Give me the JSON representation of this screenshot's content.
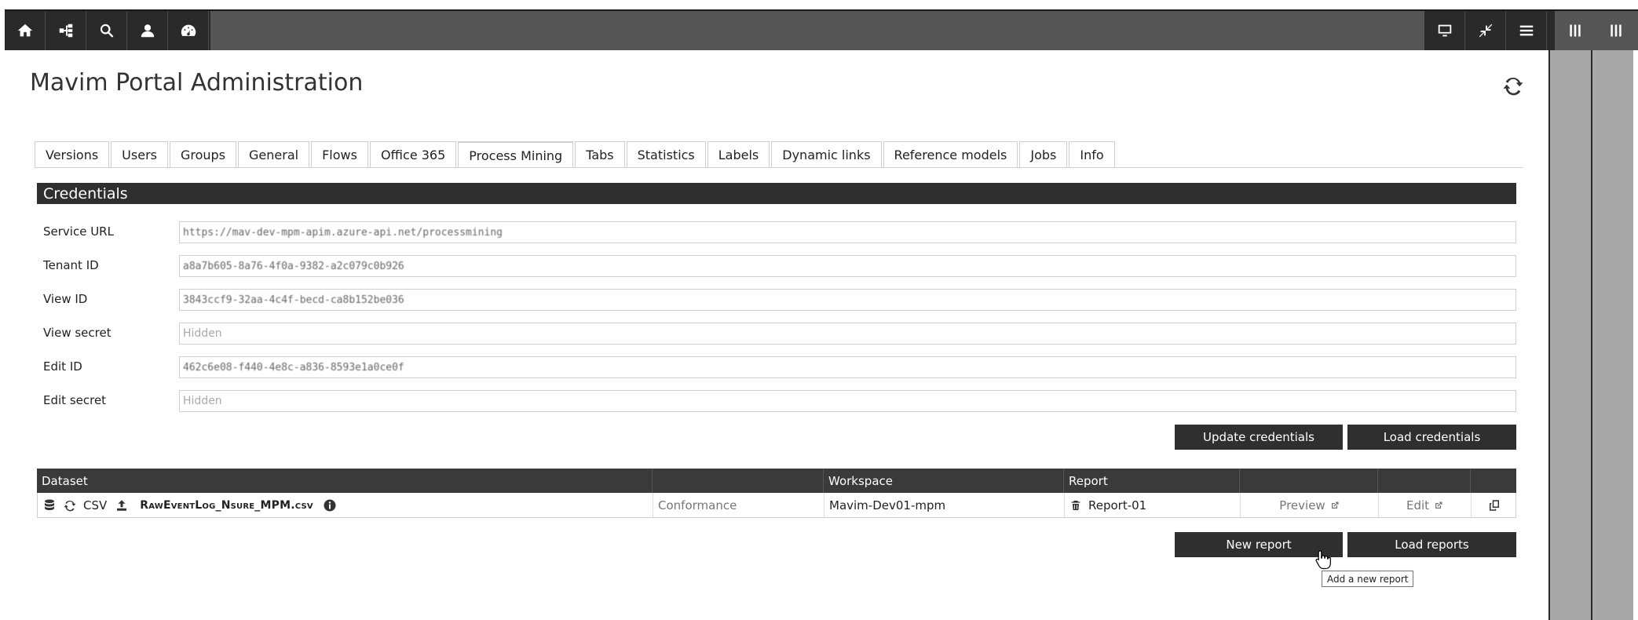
{
  "window": {
    "title": "Mavim Portal Administration"
  },
  "toolbar": {
    "left_icons": [
      "home-icon",
      "sitemap-icon",
      "search-icon",
      "user-icon",
      "dashboard-icon"
    ],
    "right_icons": [
      "monitor-icon",
      "compress-icon",
      "menu-icon",
      "columns-icon",
      "columns-icon"
    ]
  },
  "tabs": [
    {
      "label": "Versions"
    },
    {
      "label": "Users"
    },
    {
      "label": "Groups"
    },
    {
      "label": "General"
    },
    {
      "label": "Flows"
    },
    {
      "label": "Office 365"
    },
    {
      "label": "Process Mining",
      "active": true
    },
    {
      "label": "Tabs"
    },
    {
      "label": "Statistics"
    },
    {
      "label": "Labels"
    },
    {
      "label": "Dynamic links"
    },
    {
      "label": "Reference models"
    },
    {
      "label": "Jobs"
    },
    {
      "label": "Info"
    }
  ],
  "credentials": {
    "title": "Credentials",
    "fields": [
      {
        "label": "Service URL",
        "value": "https://mav-dev-mpm-apim.azure-api.net/processmining",
        "placeholder": ""
      },
      {
        "label": "Tenant ID",
        "value": "a8a7b605-8a76-4f0a-9382-a2c079c0b926",
        "placeholder": ""
      },
      {
        "label": "View ID",
        "value": "3843ccf9-32aa-4c4f-becd-ca8b152be036",
        "placeholder": ""
      },
      {
        "label": "View secret",
        "value": "",
        "placeholder": "Hidden"
      },
      {
        "label": "Edit ID",
        "value": "462c6e08-f440-4e8c-a836-8593e1a0ce0f",
        "placeholder": ""
      },
      {
        "label": "Edit secret",
        "value": "",
        "placeholder": "Hidden"
      }
    ],
    "update_button": "Update credentials",
    "load_button": "Load credentials"
  },
  "table": {
    "headers": [
      "Dataset",
      "",
      "Workspace",
      "Report",
      "",
      "",
      ""
    ],
    "rows": [
      {
        "type": "CSV",
        "file": "RawEventLog_Nsure_MPM.csv",
        "category": "Conformance",
        "workspace": "Mavim-Dev01-mpm",
        "report": "Report-01",
        "preview": "Preview",
        "edit": "Edit"
      }
    ]
  },
  "actions": {
    "new_report": "New report",
    "load_reports": "Load reports"
  },
  "tooltip": "Add a new report"
}
